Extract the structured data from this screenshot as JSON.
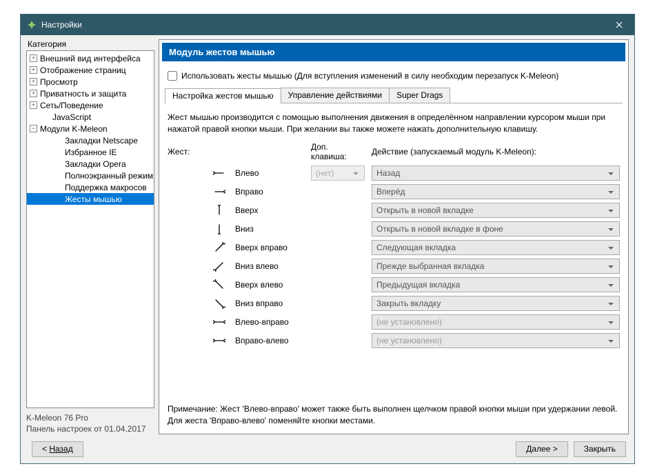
{
  "window": {
    "title": "Настройки"
  },
  "sidebar": {
    "label": "Категория",
    "nodes": [
      {
        "label": "Внешний вид интерфейса",
        "exp": "+",
        "lvl": 0
      },
      {
        "label": "Отображение страниц",
        "exp": "+",
        "lvl": 0
      },
      {
        "label": "Просмотр",
        "exp": "+",
        "lvl": 0
      },
      {
        "label": "Приватность и защита",
        "exp": "+",
        "lvl": 0
      },
      {
        "label": "Сеть/Поведение",
        "exp": "+",
        "lvl": 0
      },
      {
        "label": "JavaScript",
        "exp": "",
        "lvl": 1
      },
      {
        "label": "Модули K-Meleon",
        "exp": "−",
        "lvl": 0
      },
      {
        "label": "Закладки Netscape",
        "exp": "",
        "lvl": 2
      },
      {
        "label": "Избранное IE",
        "exp": "",
        "lvl": 2
      },
      {
        "label": "Закладки Opera",
        "exp": "",
        "lvl": 2
      },
      {
        "label": "Полноэкранный режим",
        "exp": "",
        "lvl": 2
      },
      {
        "label": "Поддержка макросов",
        "exp": "",
        "lvl": 2
      },
      {
        "label": "Жесты мышью",
        "exp": "",
        "lvl": 2,
        "selected": true
      }
    ],
    "app_name": "K-Meleon 76 Pro",
    "app_sub": "Панель настроек от 01.04.2017"
  },
  "panel": {
    "heading": "Модуль жестов мышью",
    "checkbox_label": "Использовать жесты мышью (Для вступления изменений в силу необходим перезапуск K-Meleon)",
    "tabs": [
      "Настройка жестов мышью",
      "Управление действиями",
      "Super Drags"
    ],
    "description": "Жест мышью производится с помощью выполнения движения в определённом направлении курсором мыши при нажатой правой кнопки мыши. При желании вы также можете нажать дополнительную клавишу.",
    "headers": {
      "gesture": "Жест:",
      "key": "Доп. клавиша:",
      "action": "Действие (запускаемый модуль K-Meleon):"
    },
    "key_default": "(нет)",
    "rows": [
      {
        "name": "Влево",
        "action": "Назад",
        "icon": "left",
        "showkey": true
      },
      {
        "name": "Вправо",
        "action": "Вперёд",
        "icon": "right"
      },
      {
        "name": "Вверх",
        "action": "Открыть в новой вкладке",
        "icon": "up"
      },
      {
        "name": "Вниз",
        "action": "Открыть в новой вкладке в фоне",
        "icon": "down"
      },
      {
        "name": "Вверх вправо",
        "action": "Следующая вкладка",
        "icon": "up-right"
      },
      {
        "name": "Вниз влево",
        "action": "Прежде выбранная вкладка",
        "icon": "down-left"
      },
      {
        "name": "Вверх влево",
        "action": "Предыдущая вкладка",
        "icon": "up-left"
      },
      {
        "name": "Вниз вправо",
        "action": "Закрыть вкладку",
        "icon": "down-right"
      },
      {
        "name": "Влево-вправо",
        "action": "(не установлено)",
        "icon": "left-right",
        "unset": true
      },
      {
        "name": "Вправо-влево",
        "action": "(не установлено)",
        "icon": "right-left",
        "unset": true
      }
    ],
    "note": "Примечание: Жест 'Влево-вправо' может также быть выполнен щелчком правой кнопки мыши при удержании левой. Для жеста 'Вправо-влево' поменяйте кнопки местами."
  },
  "footer": {
    "back": "Назад",
    "next": "Далее >",
    "close": "Закрыть"
  }
}
